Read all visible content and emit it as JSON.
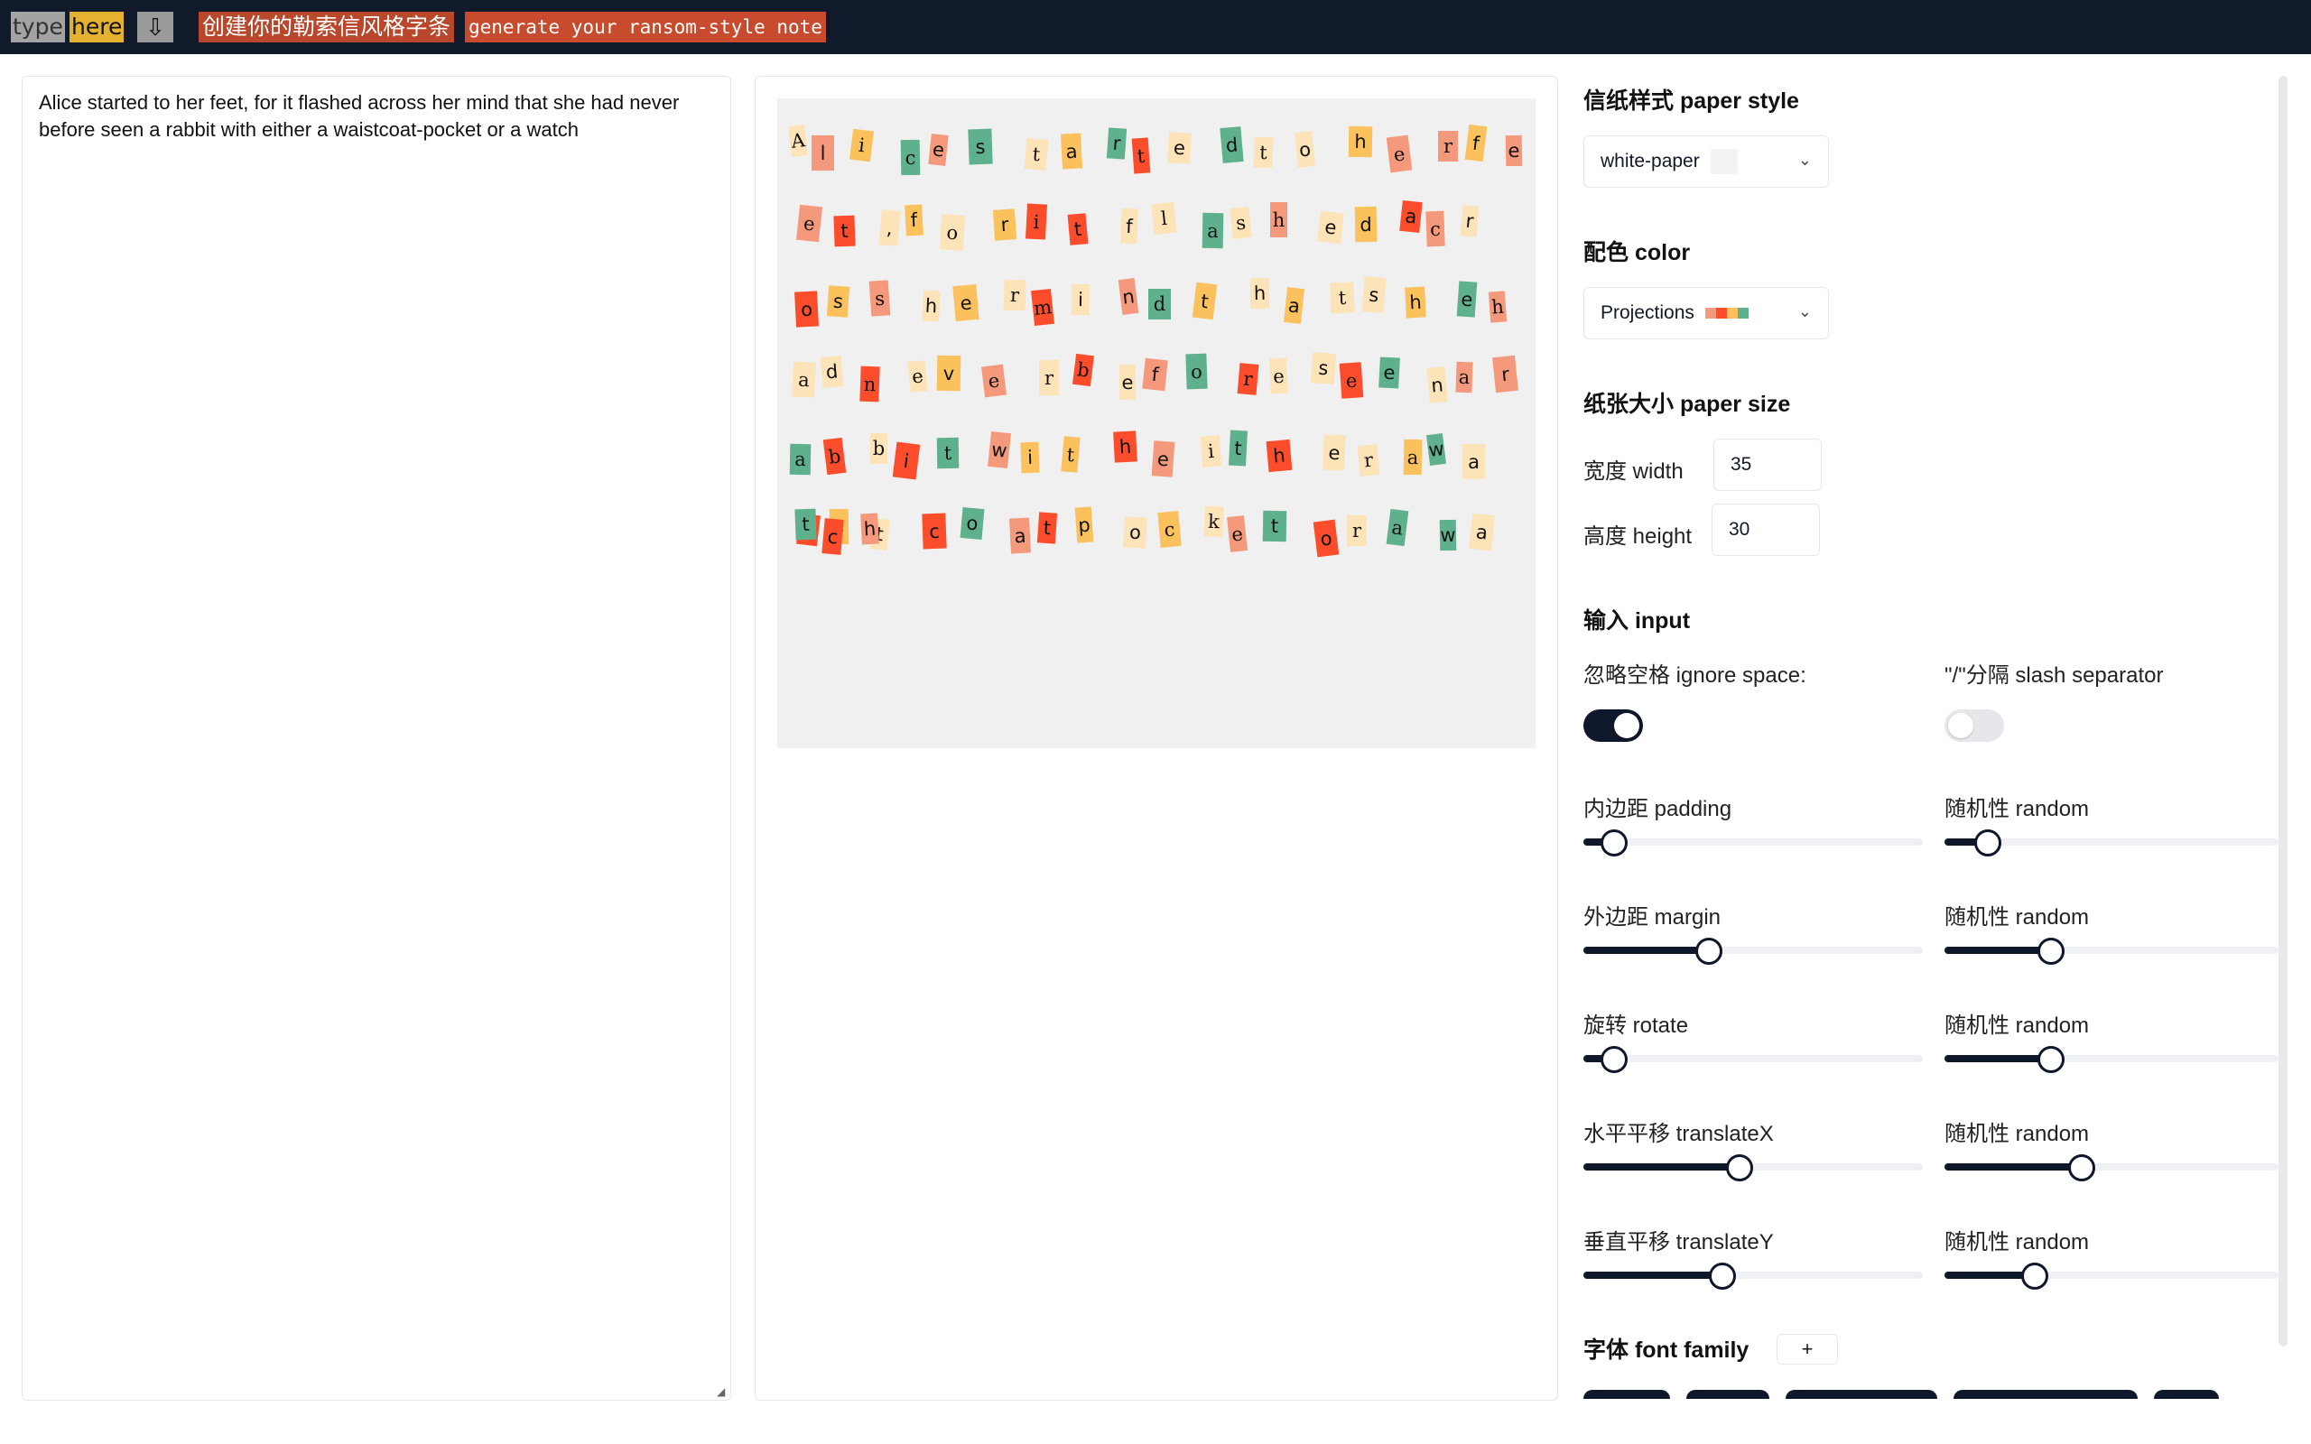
{
  "topbar": {
    "title_pieces": [
      "type",
      "here"
    ],
    "download_icon": "download-icon",
    "cn_label": "创建你的勒索信风格字条",
    "en_label": "generate your ransom-style note"
  },
  "input_text": "Alice started to her feet, for it flashed across her mind that she had never before seen a rabbit with either a waistcoat-pocket or a watch",
  "preview": {
    "paper_color": "#f0f0f0",
    "letters": [
      [
        "A",
        "#fde3b8",
        "serif"
      ],
      [
        "l",
        "#f4997c",
        "sans"
      ],
      [
        "i",
        "#fbc15c",
        "serif"
      ],
      [
        "c",
        "#5fb08d",
        "serif"
      ],
      [
        "e",
        "#f4997c",
        "sans"
      ],
      [
        "s",
        "#5fb08d",
        "sans"
      ],
      [
        "t",
        "#fde3b8",
        "serif"
      ],
      [
        "a",
        "#fbc15c",
        "sans"
      ],
      [
        "r",
        "#5fb08d",
        "sans"
      ],
      [
        "t",
        "#fb4d2b",
        "serif"
      ],
      [
        "e",
        "#fde3b8",
        "sans"
      ],
      [
        "d",
        "#5fb08d",
        "sans"
      ],
      [
        "t",
        "#fde3b8",
        "serif"
      ],
      [
        "o",
        "#fde3b8",
        "sans"
      ],
      [
        "h",
        "#fbc15c",
        "sans"
      ],
      [
        "e",
        "#f4997c",
        "serif"
      ],
      [
        "r",
        "#f4997c",
        "serif"
      ],
      [
        "f",
        "#fbc15c",
        "sans"
      ],
      [
        "e",
        "#f4997c",
        "sans"
      ],
      [
        "e",
        "#f4997c",
        "serif"
      ],
      [
        "t",
        "#fb4d2b",
        "sans"
      ],
      [
        ",",
        "#fde3b8",
        "sans"
      ],
      [
        "f",
        "#fbc15c",
        "sans"
      ],
      [
        "o",
        "#fde3b8",
        "serif"
      ],
      [
        "r",
        "#fbc15c",
        "sans"
      ],
      [
        "i",
        "#fb4d2b",
        "serif"
      ],
      [
        "t",
        "#fb4d2b",
        "sans"
      ],
      [
        "f",
        "#fde3b8",
        "sans"
      ],
      [
        "l",
        "#fde3b8",
        "serif"
      ],
      [
        "a",
        "#5fb08d",
        "serif"
      ],
      [
        "s",
        "#fde3b8",
        "serif"
      ],
      [
        "h",
        "#f4997c",
        "serif"
      ],
      [
        "e",
        "#fde3b8",
        "sans"
      ],
      [
        "d",
        "#fbc15c",
        "sans"
      ],
      [
        "a",
        "#fb4d2b",
        "sans"
      ],
      [
        "c",
        "#f4997c",
        "serif"
      ],
      [
        "r",
        "#fde3b8",
        "sans"
      ],
      [
        "o",
        "#fb4d2b",
        "sans"
      ],
      [
        "s",
        "#fbc15c",
        "sans"
      ],
      [
        "s",
        "#f4997c",
        "serif"
      ],
      [
        "h",
        "#fde3b8",
        "sans"
      ],
      [
        "e",
        "#fbc15c",
        "sans"
      ],
      [
        "r",
        "#fde3b8",
        "serif"
      ],
      [
        "m",
        "#fb4d2b",
        "serif"
      ],
      [
        "i",
        "#fde3b8",
        "sans"
      ],
      [
        "n",
        "#f4997c",
        "sans"
      ],
      [
        "d",
        "#5fb08d",
        "serif"
      ],
      [
        "t",
        "#fbc15c",
        "sans"
      ],
      [
        "h",
        "#fde3b8",
        "sans"
      ],
      [
        "a",
        "#fbc15c",
        "sans"
      ],
      [
        "t",
        "#fde3b8",
        "serif"
      ],
      [
        "s",
        "#fde3b8",
        "sans"
      ],
      [
        "h",
        "#fbc15c",
        "sans"
      ],
      [
        "e",
        "#5fb08d",
        "sans"
      ],
      [
        "h",
        "#f4997c",
        "serif"
      ],
      [
        "a",
        "#fde3b8",
        "serif"
      ],
      [
        "d",
        "#fde3b8",
        "sans"
      ],
      [
        "n",
        "#fb4d2b",
        "serif"
      ],
      [
        "e",
        "#fde3b8",
        "serif"
      ],
      [
        "v",
        "#fbc15c",
        "sans"
      ],
      [
        "e",
        "#f4997c",
        "serif"
      ],
      [
        "r",
        "#fde3b8",
        "serif"
      ],
      [
        "b",
        "#fb4d2b",
        "serif"
      ],
      [
        "e",
        "#fde3b8",
        "sans"
      ],
      [
        "f",
        "#f4997c",
        "sans"
      ],
      [
        "o",
        "#5fb08d",
        "serif"
      ],
      [
        "r",
        "#fb4d2b",
        "serif"
      ],
      [
        "e",
        "#fde3b8",
        "serif"
      ],
      [
        "s",
        "#fde3b8",
        "sans"
      ],
      [
        "e",
        "#fb4d2b",
        "serif"
      ],
      [
        "e",
        "#5fb08d",
        "sans"
      ],
      [
        "n",
        "#fde3b8",
        "sans"
      ],
      [
        "a",
        "#f4997c",
        "serif"
      ],
      [
        "r",
        "#f4997c",
        "sans"
      ],
      [
        "a",
        "#5fb08d",
        "serif"
      ],
      [
        "b",
        "#fb4d2b",
        "serif"
      ],
      [
        "b",
        "#fde3b8",
        "serif"
      ],
      [
        "i",
        "#fb4d2b",
        "sans"
      ],
      [
        "t",
        "#5fb08d",
        "serif"
      ],
      [
        "w",
        "#f4997c",
        "sans"
      ],
      [
        "i",
        "#fbc15c",
        "sans"
      ],
      [
        "t",
        "#fbc15c",
        "serif"
      ],
      [
        "h",
        "#fb4d2b",
        "sans"
      ],
      [
        "e",
        "#f4997c",
        "sans"
      ],
      [
        "i",
        "#fde3b8",
        "serif"
      ],
      [
        "t",
        "#5fb08d",
        "sans"
      ],
      [
        "h",
        "#fb4d2b",
        "sans"
      ],
      [
        "e",
        "#fde3b8",
        "sans"
      ],
      [
        "r",
        "#fde3b8",
        "serif"
      ],
      [
        "a",
        "#fbc15c",
        "serif"
      ],
      [
        "w",
        "#5fb08d",
        "sans"
      ],
      [
        "a",
        "#fde3b8",
        "sans"
      ],
      [
        "i",
        "#fb4d2b",
        "serif"
      ],
      [
        "s",
        "#fbc15c",
        "serif"
      ],
      [
        "t",
        "#fde3b8",
        "sans"
      ],
      [
        "c",
        "#fb4d2b",
        "sans"
      ],
      [
        "o",
        "#5fb08d",
        "sans"
      ],
      [
        "a",
        "#f4997c",
        "sans"
      ],
      [
        "t",
        "#fb4d2b",
        "sans"
      ],
      [
        "p",
        "#fbc15c",
        "sans"
      ],
      [
        "o",
        "#fde3b8",
        "sans"
      ],
      [
        "c",
        "#fbc15c",
        "serif"
      ],
      [
        "k",
        "#fde3b8",
        "serif"
      ],
      [
        "e",
        "#f4997c",
        "serif"
      ],
      [
        "t",
        "#5fb08d",
        "sans"
      ],
      [
        "o",
        "#fb4d2b",
        "sans"
      ],
      [
        "r",
        "#fde3b8",
        "serif"
      ],
      [
        "a",
        "#5fb08d",
        "serif"
      ],
      [
        "w",
        "#5fb08d",
        "sans"
      ],
      [
        "a",
        "#fde3b8",
        "sans"
      ],
      [
        "t",
        "#5fb08d",
        "sans"
      ],
      [
        "c",
        "#fb4d2b",
        "sans"
      ],
      [
        "h",
        "#f4997c",
        "sans"
      ]
    ]
  },
  "settings": {
    "paper_style": {
      "heading": "信纸样式 paper style",
      "value": "white-paper",
      "swatch": "#f2f2f2"
    },
    "color": {
      "heading": "配色 color",
      "value": "Projections",
      "palette": [
        "#f4997c",
        "#fb4d2b",
        "#fbc15c",
        "#5fb08d"
      ]
    },
    "paper_size": {
      "heading": "纸张大小 paper size",
      "width_label": "宽度 width",
      "width": "35",
      "height_label": "高度 height",
      "height": "30"
    },
    "input": {
      "heading": "输入 input",
      "ignore_space_label": "忽略空格 ignore space:",
      "ignore_space": true,
      "slash_label": "\"/\"分隔 slash separator",
      "slash": false
    },
    "sliders": [
      {
        "label": "内边距 padding",
        "value": 0.09,
        "random_label": "随机性 random",
        "random": 0.13
      },
      {
        "label": "外边距 margin",
        "value": 0.37,
        "random_label": "随机性 random",
        "random": 0.32
      },
      {
        "label": "旋转 rotate",
        "value": 0.09,
        "random_label": "随机性 random",
        "random": 0.32
      },
      {
        "label": "水平平移 translateX",
        "value": 0.46,
        "random_label": "随机性 random",
        "random": 0.41
      },
      {
        "label": "垂直平移 translateY",
        "value": 0.41,
        "random_label": "随机性 random",
        "random": 0.27
      }
    ],
    "font_family": {
      "heading": "字体 font family",
      "add_label": "+"
    }
  }
}
